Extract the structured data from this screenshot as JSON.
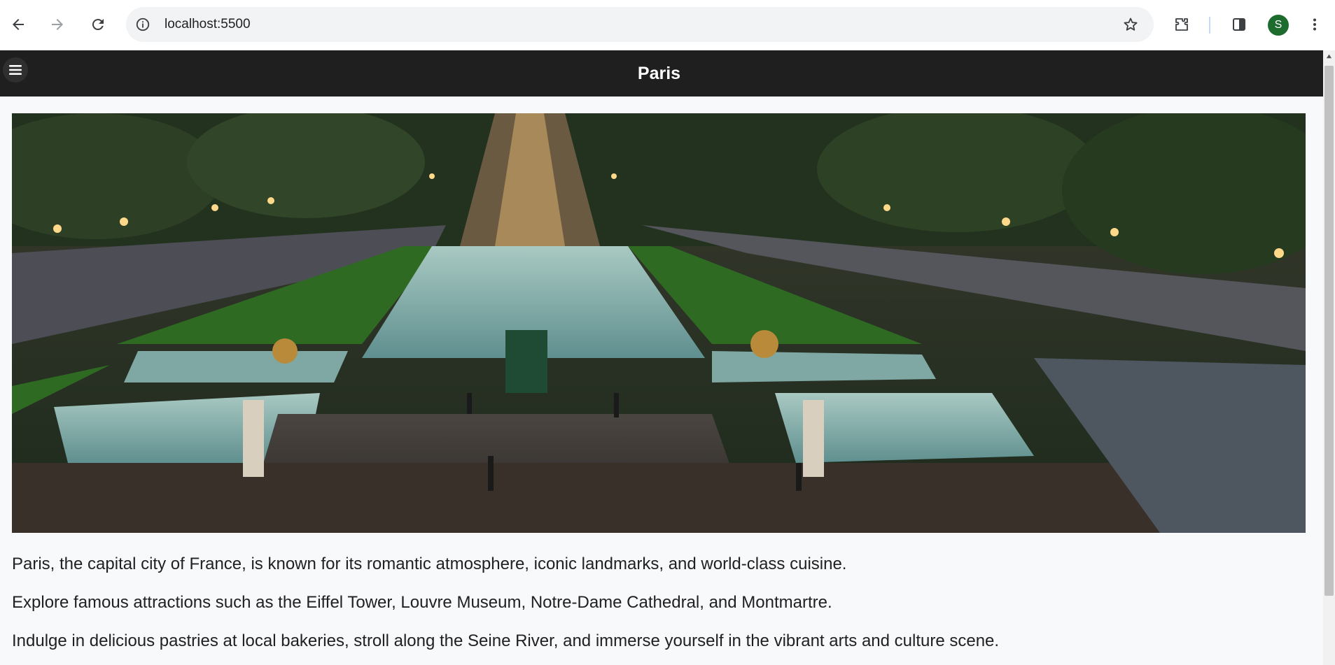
{
  "browser": {
    "url": "localhost:5500",
    "profile_initial": "S",
    "icons": {
      "back": "arrow-left-icon",
      "forward": "arrow-right-icon",
      "reload": "reload-icon",
      "site_info": "info-icon",
      "bookmark": "star-icon",
      "extensions": "puzzle-icon",
      "side_panel": "side-panel-icon",
      "menu": "kebab-menu-icon"
    }
  },
  "header": {
    "title": "Paris",
    "menu_icon": "hamburger-icon",
    "background": "#1f1f1f"
  },
  "hero": {
    "image_subject": "Trocadero fountains at dusk facing the Eiffel Tower"
  },
  "content": {
    "paragraphs": [
      "Paris, the capital city of France, is known for its romantic atmosphere, iconic landmarks, and world-class cuisine.",
      "Explore famous attractions such as the Eiffel Tower, Louvre Museum, Notre-Dame Cathedral, and Montmartre.",
      "Indulge in delicious pastries at local bakeries, stroll along the Seine River, and immerse yourself in the vibrant arts and culture scene."
    ]
  }
}
